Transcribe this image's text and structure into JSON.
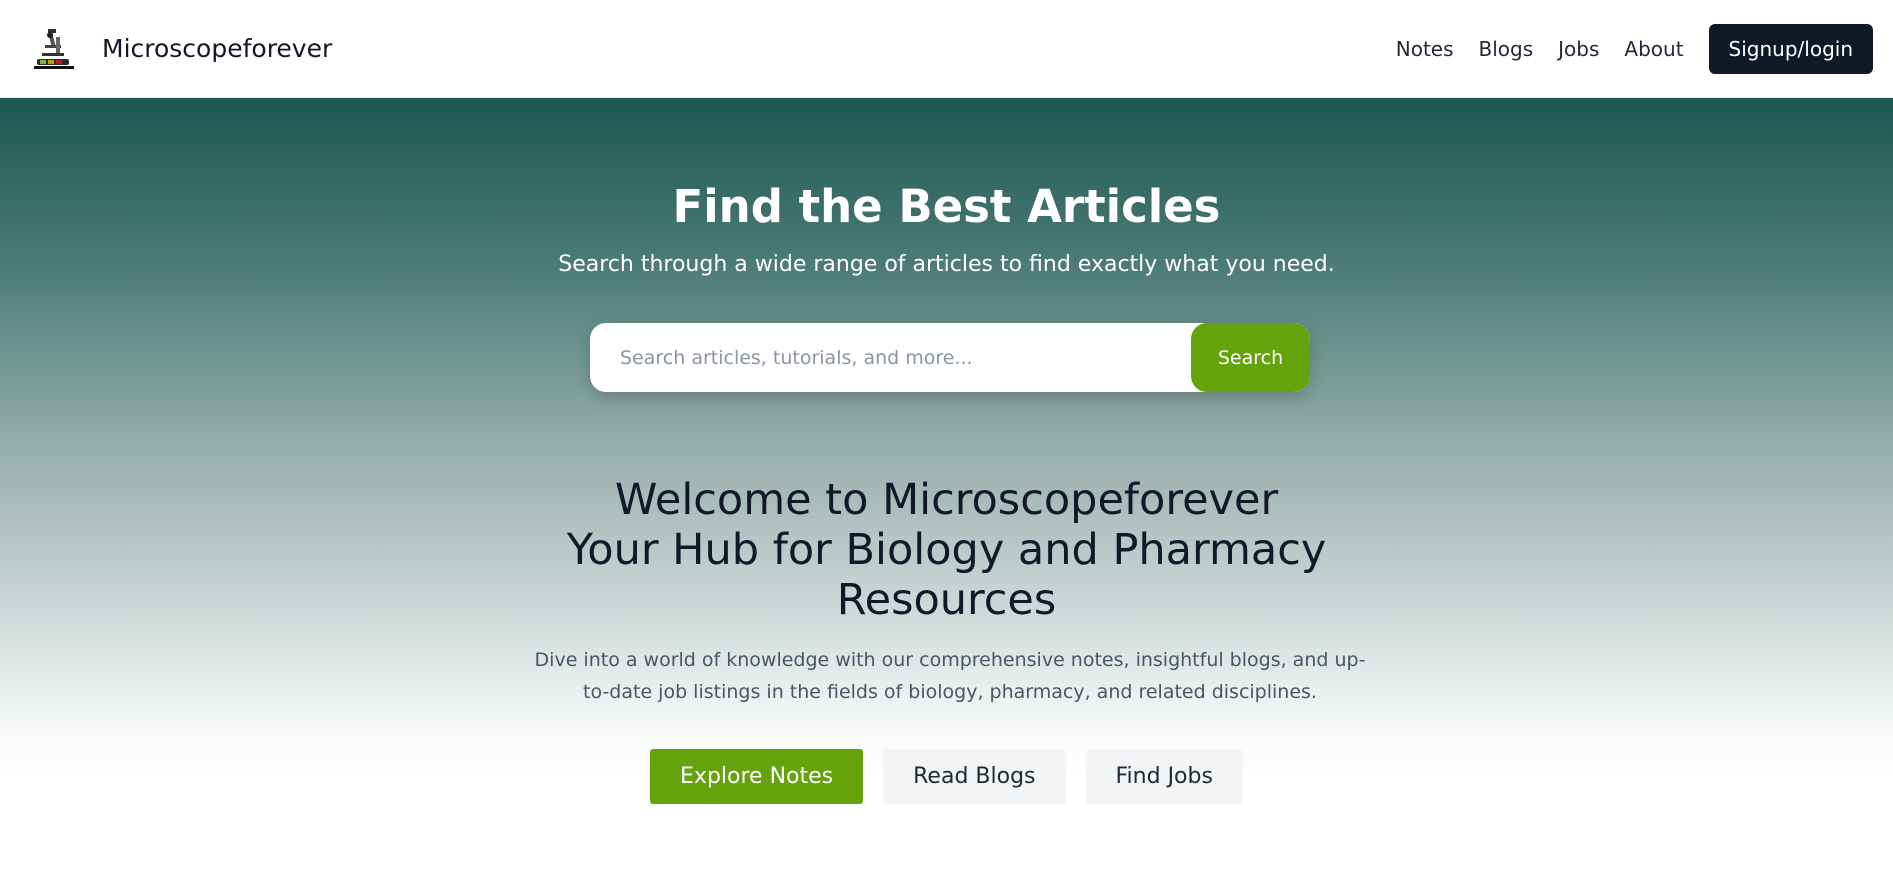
{
  "header": {
    "logo_icon": "microscope-logo-icon",
    "brand": "Microscopeforever",
    "nav": [
      "Notes",
      "Blogs",
      "Jobs",
      "About"
    ],
    "signup_label": "Signup/login"
  },
  "hero": {
    "title": "Find the Best Articles",
    "subtitle": "Search through a wide range of articles to find exactly what you need.",
    "search": {
      "placeholder": "Search articles, tutorials, and more...",
      "value": "",
      "button_label": "Search"
    }
  },
  "welcome": {
    "line1": "Welcome to Microscopeforever",
    "line2": "Your Hub for Biology and Pharmacy",
    "line3": "Resources",
    "description": "Dive into a world of knowledge with our comprehensive notes, insightful blogs, and up-to-date job listings in the fields of biology, pharmacy, and related disciplines.",
    "buttons": [
      "Explore Notes",
      "Read Blogs",
      "Find Jobs"
    ]
  },
  "colors": {
    "accent_green": "#65a30d",
    "dark_navy": "#111827",
    "hero_top_teal": "#1c5751"
  }
}
